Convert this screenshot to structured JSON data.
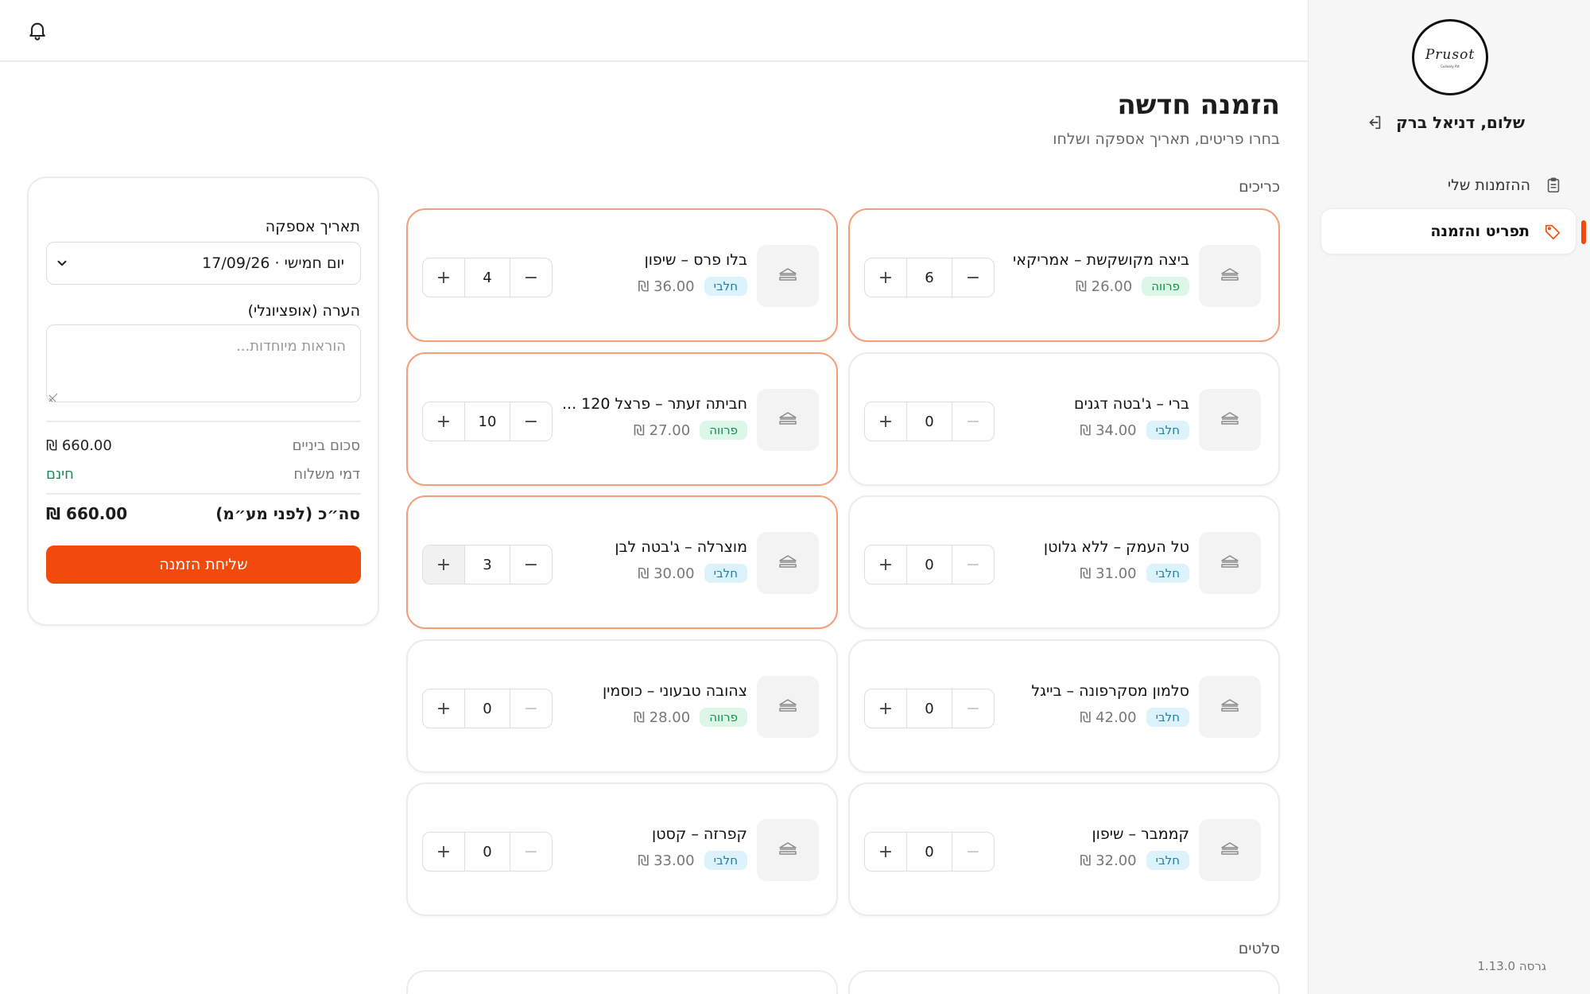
{
  "sidebar": {
    "logo_text": "Prusot",
    "logo_sub": "Culinary Art",
    "greeting": "שלום, דניאל ברק",
    "items": [
      {
        "label": "ההזמנות שלי",
        "icon": "clipboard-icon"
      },
      {
        "label": "תפריט והזמנה",
        "icon": "tag-icon"
      }
    ],
    "active_index": 1,
    "version": "גרסה 1.13.0"
  },
  "header": {
    "title": "הזמנה חדשה",
    "subtitle": "בחרו פריטים, תאריך אספקה ושלחו"
  },
  "sections": [
    "כריכים",
    "סלטים"
  ],
  "products": [
    {
      "name": "ביצה מקושקשת – אמריקאי",
      "tag": "פרווה",
      "tag_type": "parve",
      "price": "₪ 26.00",
      "qty": "6",
      "selected": true
    },
    {
      "name": "בלו פרס – שיפון",
      "tag": "חלבי",
      "tag_type": "dairy",
      "price": "₪ 36.00",
      "qty": "4",
      "selected": true
    },
    {
      "name": "ברי – ג'בטה דגנים",
      "tag": "חלבי",
      "tag_type": "dairy",
      "price": "₪ 34.00",
      "qty": "0",
      "selected": false
    },
    {
      "name": "חביתה זעתר – פרצל 120 ...",
      "tag": "פרווה",
      "tag_type": "parve",
      "price": "₪ 27.00",
      "qty": "10",
      "selected": true
    },
    {
      "name": "טל העמק – ללא גלוטן",
      "tag": "חלבי",
      "tag_type": "dairy",
      "price": "₪ 31.00",
      "qty": "0",
      "selected": false
    },
    {
      "name": "מוצרלה – ג'בטה לבן",
      "tag": "חלבי",
      "tag_type": "dairy",
      "price": "₪ 30.00",
      "qty": "3",
      "selected": true
    },
    {
      "name": "סלמון מסקרפונה – בייגל",
      "tag": "חלבי",
      "tag_type": "dairy",
      "price": "₪ 42.00",
      "qty": "0",
      "selected": false
    },
    {
      "name": "צהובה טבעוני – כוסמין",
      "tag": "פרווה",
      "tag_type": "parve",
      "price": "₪ 28.00",
      "qty": "0",
      "selected": false
    },
    {
      "name": "קממבר – שיפון",
      "tag": "חלבי",
      "tag_type": "dairy",
      "price": "₪ 32.00",
      "qty": "0",
      "selected": false
    },
    {
      "name": "קפרזה – קסטן",
      "tag": "חלבי",
      "tag_type": "dairy",
      "price": "₪ 33.00",
      "qty": "0",
      "selected": false
    }
  ],
  "summary": {
    "date_label": "תאריך אספקה",
    "date_value": "יום חמישי · 17/09/26",
    "note_label": "הערה (אופציונלי)",
    "note_placeholder": "הוראות מיוחדות...",
    "subtotal_label": "סכום ביניים",
    "subtotal_value": "₪ 660.00",
    "delivery_label": "דמי משלוח",
    "delivery_value": "חינם",
    "total_label": "סה״כ (לפני מע״מ)",
    "total_value": "₪ 660.00",
    "send_label": "שליחת הזמנה"
  },
  "colors": {
    "accent": "#f24a0c",
    "selected_border": "#f2a07b",
    "dairy_bg": "#ddf3fb",
    "parve_bg": "#dcf7e8",
    "free_text": "#168a4f"
  }
}
